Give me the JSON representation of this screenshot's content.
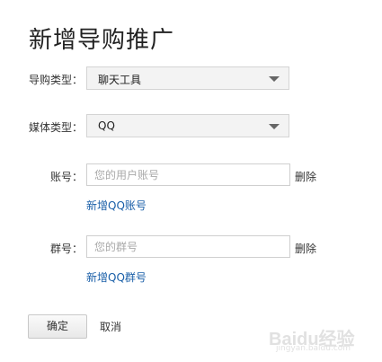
{
  "page": {
    "title": "新增导购推广"
  },
  "form": {
    "guide_type": {
      "label": "导购类型：",
      "value": "聊天工具"
    },
    "media_type": {
      "label": "媒体类型：",
      "value": "QQ"
    },
    "account": {
      "label": "账号：",
      "placeholder": "您的用户账号",
      "delete_label": "删除",
      "add_label": "新增QQ账号"
    },
    "group": {
      "label": "群号：",
      "placeholder": "您的群号",
      "delete_label": "删除",
      "add_label": "新增QQ群号"
    }
  },
  "actions": {
    "confirm_label": "确定",
    "cancel_label": "取消"
  },
  "watermark": {
    "text": "Baidu经验",
    "sub": "jingyan.baidu.com"
  },
  "colors": {
    "link": "#1a5fa8",
    "select_bg": "#f3f3f3"
  }
}
